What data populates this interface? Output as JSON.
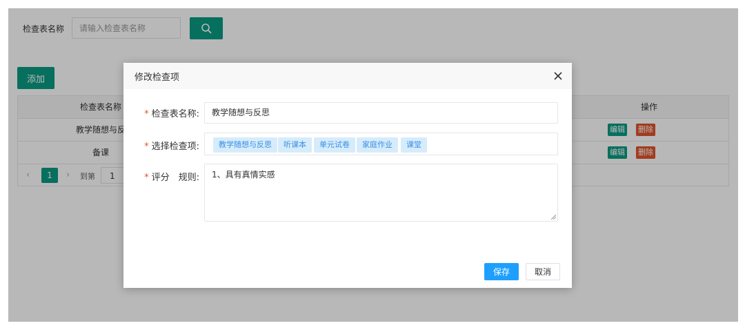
{
  "search": {
    "label": "检查表名称",
    "placeholder": "请输入检查表名称"
  },
  "toolbar": {
    "add_label": "添加"
  },
  "table": {
    "columns": [
      "检查表名称",
      "操作"
    ],
    "rows": [
      {
        "name": "教学随想与反",
        "edit": "编辑",
        "delete": "删除"
      },
      {
        "name": "备课",
        "edit": "编辑",
        "delete": "删除"
      }
    ]
  },
  "pagination": {
    "current_page": "1",
    "goto_label": "到第",
    "goto_value": "1"
  },
  "modal": {
    "title": "修改检查项",
    "fields": {
      "name_label": "检查表名称:",
      "name_value": "教学随想与反思",
      "items_label": "选择检查项:",
      "items": [
        "教学随想与反思",
        "听课本",
        "单元试卷",
        "家庭作业",
        "课堂"
      ],
      "rule_label": "评分　规则:",
      "rule_value": "1、具有真情实感"
    },
    "required_mark": "*",
    "save_label": "保存",
    "cancel_label": "取消"
  },
  "colors": {
    "primary_green": "#0b9a82",
    "danger": "#e0542b",
    "save_blue": "#1e9fff",
    "tag_bg": "#d6ecfb",
    "tag_text": "#3a8ee6"
  }
}
